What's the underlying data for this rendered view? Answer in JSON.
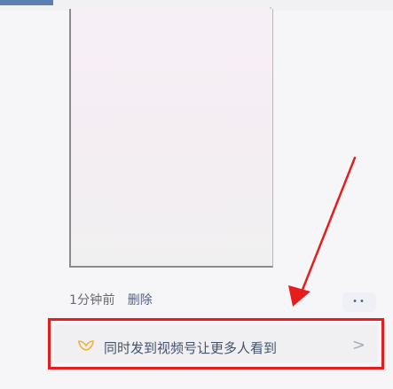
{
  "post": {
    "time_label": "1分钟前",
    "delete_label": "删除",
    "more_label": "••"
  },
  "channels_promo": {
    "text": "同时发到视频号让更多人看到",
    "chevron": ">"
  },
  "colors": {
    "highlight_red": "#e51d1d",
    "link_blue": "#55628a",
    "text_gray": "#666a70"
  },
  "icons": {
    "channels": "channels-butterfly-icon",
    "chevron": "chevron-right-icon",
    "more": "more-dots-icon"
  }
}
